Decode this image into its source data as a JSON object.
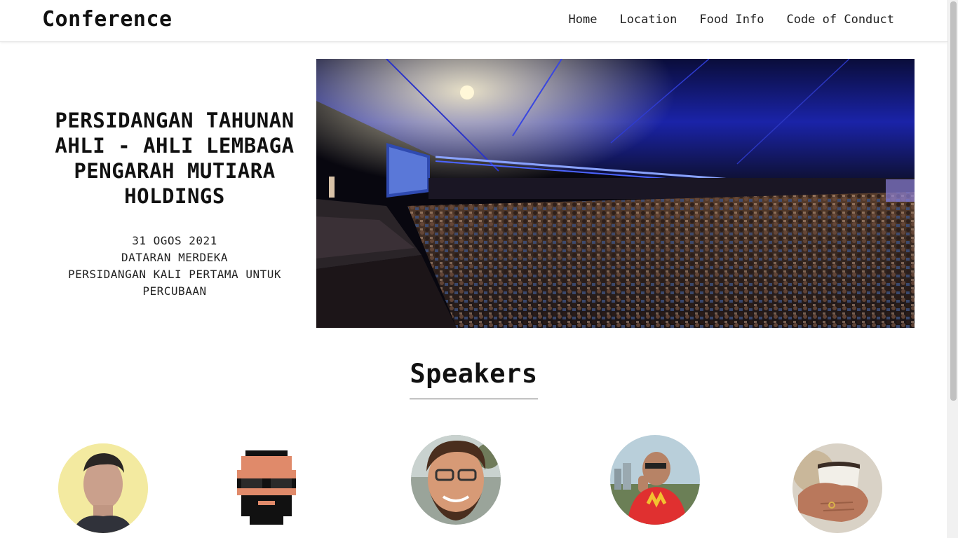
{
  "header": {
    "brand": "Conference",
    "nav": [
      {
        "label": "Home"
      },
      {
        "label": "Location"
      },
      {
        "label": "Food Info"
      },
      {
        "label": "Code of Conduct"
      }
    ]
  },
  "hero": {
    "title": "PERSIDANGAN TAHUNAN AHLI - AHLI LEMBAGA PENGARAH MUTIARA HOLDINGS",
    "date": "31 OGOS 2021",
    "venue": "DATARAN MERDEKA",
    "description": "PERSIDANGAN KALI PERTAMA UNTUK PERCUBAAN",
    "image_label": "conference-hall-photo"
  },
  "speakers": {
    "heading": "Speakers",
    "items": [
      {
        "avatar": "speaker-avatar-man-portrait"
      },
      {
        "avatar": "speaker-avatar-pixel-art-bearded-man"
      },
      {
        "avatar": "speaker-avatar-man-with-glasses"
      },
      {
        "avatar": "speaker-avatar-man-red-shirt"
      },
      {
        "avatar": "speaker-avatar-hand-with-cup"
      }
    ]
  }
}
